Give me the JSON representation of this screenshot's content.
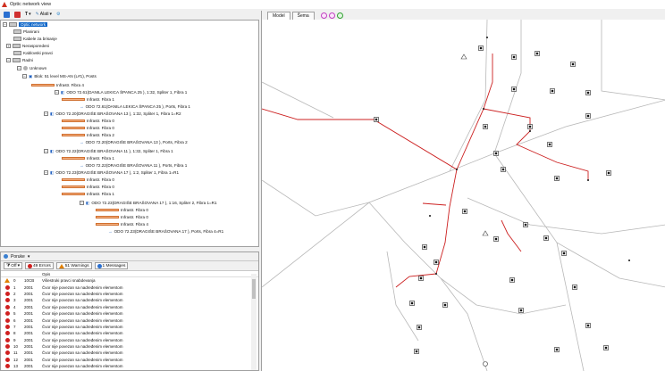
{
  "window": {
    "title": "Optic network view"
  },
  "toolbar": {
    "text_tool_label": "T",
    "alati_label": "Alati"
  },
  "tree": {
    "root_label": "Optic network",
    "folders": [
      "Planirani",
      "Kabele za brisanje",
      "Nerasporedeni",
      "Kablovski pravci",
      "Radni"
    ],
    "unknown_label": "Unknown",
    "block_label": "Blok: 51 level MS-AN (L#1), Posts",
    "rows": [
      {
        "label": "Infrastr. Fibra 4"
      },
      {
        "label": "ODO 72.61(DANILA LEKICA ŠPANCA 25 ), 1:32, Spliter 1, Fibra 1"
      },
      {
        "label": "Infrastr. Fibra 1"
      },
      {
        "label": "ODO 72.61(DANILA LEKICA ŠPANCA 25 ), Ports, Fibra 1"
      },
      {
        "label": "ODO 72.20(DRAGIŠE BRAŠOVANA 13 ), 1:32, Spliter 1, Fibra 1=R2"
      },
      {
        "label": "Infrastr. Fibra 0"
      },
      {
        "label": "Infrastr. Fibra 0"
      },
      {
        "label": "Infrastr. Fibra 2"
      },
      {
        "label": "ODO 72.20(DRAGIŠE BRAŠOVANA 13 ), Ports, Fibra 2"
      },
      {
        "label": "ODO 72.22(DRAGIŠE BRAŠOVANA 11 ), 1:32, Spliter 1, Fibra 1"
      },
      {
        "label": "Infrastr. Fibra 1"
      },
      {
        "label": "ODO 72.22(DRAGIŠE BRAŠOVANA 11 ), Ports, Fibra 1"
      },
      {
        "label": "ODO 72.23(DRAGIŠE BRAŠOVANA 17 ), 1:2, Spliter 1, Fibra 1=R1"
      },
      {
        "label": "Infrastr. Fibra 0"
      },
      {
        "label": "Infrastr. Fibra 0"
      },
      {
        "label": "Infrastr. Fibra 1"
      },
      {
        "label": "ODO 72.23(DRAGIŠE BRAŠOVANA 17 ), 1:16, Spliter 2, Fibra 1=R1"
      },
      {
        "label": "Infrastr. Fibra 0"
      },
      {
        "label": "Infrastr. Fibra 0"
      },
      {
        "label": "Infrastr. Fibra 4"
      },
      {
        "label": "ODO 72.23(DRAGIŠE BRAŠOVANA 17 ), Ports, Fibra 4=R1"
      }
    ]
  },
  "messages_panel": {
    "title": "Poruke",
    "filter_label": "Off",
    "errors_label": "49 Errors",
    "warnings_label": "51 Warnings",
    "messages_label": "1 Messages",
    "columns": [
      "",
      "",
      "",
      "Opis"
    ],
    "rows": [
      {
        "type": "warning",
        "num": "0",
        "code": "10CB",
        "text": "Višestruki pravci snabdevanja"
      },
      {
        "type": "error",
        "num": "1",
        "code": "2001",
        "text": "Čvor nije povezan sa nadređenim elementom"
      },
      {
        "type": "error",
        "num": "2",
        "code": "2001",
        "text": "Čvor nije povezan sa nadređenim elementom"
      },
      {
        "type": "error",
        "num": "3",
        "code": "2001",
        "text": "Čvor nije povezan sa nadređenim elementom"
      },
      {
        "type": "error",
        "num": "4",
        "code": "2001",
        "text": "Čvor nije povezan sa nadređenim elementom"
      },
      {
        "type": "error",
        "num": "5",
        "code": "2001",
        "text": "Čvor nije povezan sa nadređenim elementom"
      },
      {
        "type": "error",
        "num": "6",
        "code": "2001",
        "text": "Čvor nije povezan sa nadređenim elementom"
      },
      {
        "type": "error",
        "num": "7",
        "code": "2001",
        "text": "Čvor nije povezan sa nadređenim elementom"
      },
      {
        "type": "error",
        "num": "8",
        "code": "2001",
        "text": "Čvor nije povezan sa nadređenim elementom"
      },
      {
        "type": "error",
        "num": "9",
        "code": "2001",
        "text": "Čvor nije povezan sa nadređenim elementom"
      },
      {
        "type": "error",
        "num": "10",
        "code": "2001",
        "text": "Čvor nije povezan sa nadređenim elementom"
      },
      {
        "type": "error",
        "num": "11",
        "code": "2001",
        "text": "Čvor nije povezan sa nadređenim elementom"
      },
      {
        "type": "error",
        "num": "12",
        "code": "2001",
        "text": "Čvor nije povezan sa nadređenim elementom"
      },
      {
        "type": "error",
        "num": "13",
        "code": "2001",
        "text": "Čvor nije povezan sa nadređenim elementom"
      }
    ]
  },
  "map_view": {
    "tabs": [
      "Model",
      "Šema"
    ],
    "colors": {
      "fiber_route": "#d02020",
      "street": "#b0b0b0",
      "node_fill": "#111111"
    }
  }
}
